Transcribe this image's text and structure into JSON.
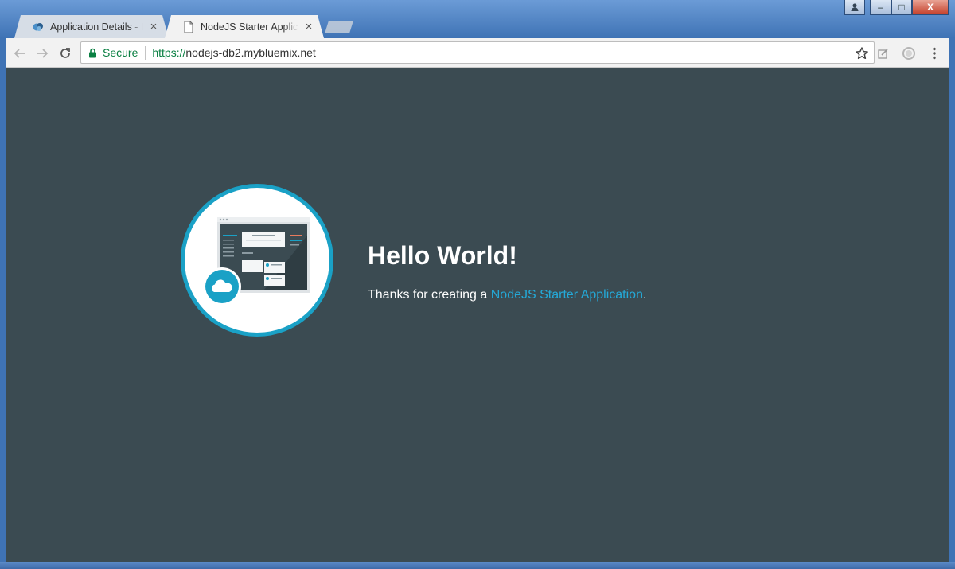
{
  "tabs": [
    {
      "title": "Application Details - IBM",
      "active": false,
      "icon": "ibm-cloud-favicon-icon"
    },
    {
      "title": "NodeJS Starter Application",
      "active": true,
      "icon": "document-favicon-icon"
    }
  ],
  "window_controls": {
    "minimize": "–",
    "maximize": "□",
    "close": "X"
  },
  "omnibox": {
    "secure_label": "Secure",
    "scheme": "https://",
    "host": "nodejs-db2.mybluemix.net"
  },
  "page": {
    "heading": "Hello World!",
    "body_prefix": "Thanks for creating a ",
    "link_text": "NodeJS Starter Application",
    "body_suffix": "."
  },
  "colors": {
    "page_background": "#3b4b52",
    "accent": "#1aa1c6",
    "link": "#24a9d8",
    "secure_green": "#0b8043"
  }
}
